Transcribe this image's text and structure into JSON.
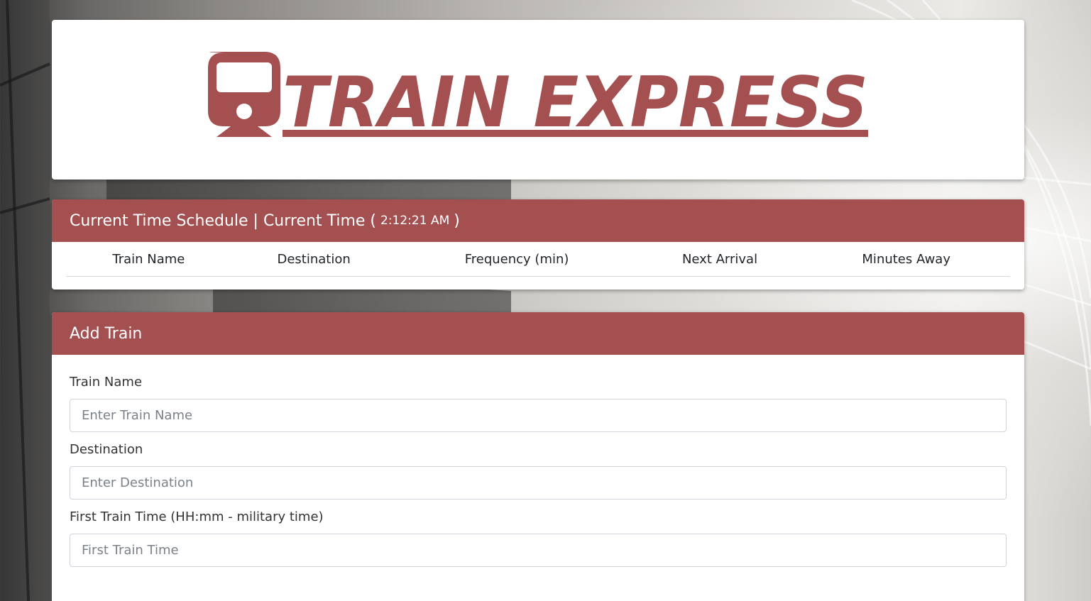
{
  "brand": {
    "logo_text": "TRAIN EXPRESS",
    "accent_color": "#a44f50"
  },
  "schedule": {
    "header_prefix": "Current Time Schedule | Current Time (",
    "current_time": "2:12:21 AM",
    "header_suffix": ")",
    "columns": [
      "Train Name",
      "Destination",
      "Frequency (min)",
      "Next Arrival",
      "Minutes Away"
    ]
  },
  "add_train": {
    "title": "Add Train",
    "fields": [
      {
        "label": "Train Name",
        "placeholder": "Enter Train Name"
      },
      {
        "label": "Destination",
        "placeholder": "Enter Destination"
      },
      {
        "label": "First Train Time (HH:mm - military time)",
        "placeholder": "First Train Time"
      }
    ]
  }
}
